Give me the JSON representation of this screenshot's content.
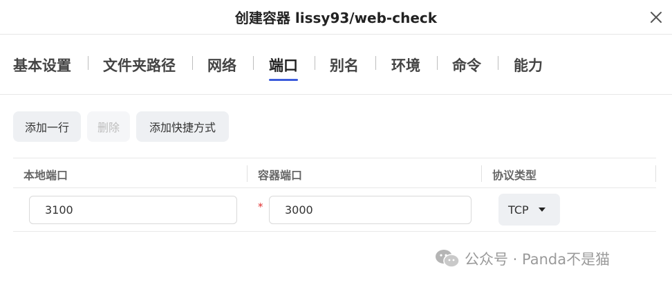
{
  "dialog": {
    "title": "创建容器 lissy93/web-check",
    "close_icon": "close-icon"
  },
  "tabs": [
    {
      "label": "基本设置",
      "active": false
    },
    {
      "label": "文件夹路径",
      "active": false
    },
    {
      "label": "网络",
      "active": false
    },
    {
      "label": "端口",
      "active": true
    },
    {
      "label": "别名",
      "active": false
    },
    {
      "label": "环境",
      "active": false
    },
    {
      "label": "命令",
      "active": false
    },
    {
      "label": "能力",
      "active": false
    }
  ],
  "toolbar": {
    "add_row": "添加一行",
    "delete": "删除",
    "add_shortcut": "添加快捷方式"
  },
  "table": {
    "headers": [
      "本地端口",
      "容器端口",
      "协议类型"
    ],
    "rows": [
      {
        "local_port": "3100",
        "container_port": "3000",
        "required_mark": "*",
        "protocol": "TCP"
      }
    ]
  },
  "watermark": {
    "text": "公众号 · Panda不是猫",
    "icon": "wechat-icon"
  },
  "colors": {
    "accent": "#3b5bdb",
    "required": "#e03131",
    "button_bg": "#eef0f3"
  }
}
